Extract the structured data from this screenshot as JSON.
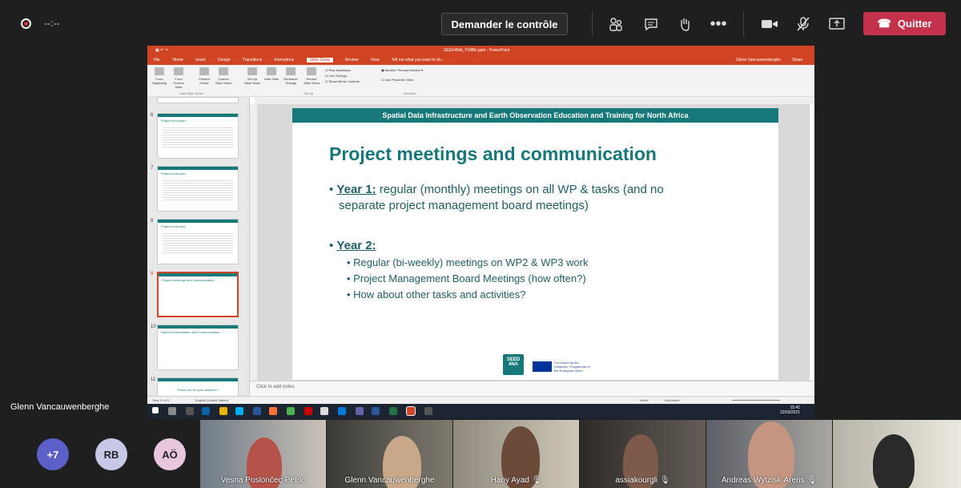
{
  "topbar": {
    "timer": "--:--",
    "control_label": "Demander le contrôle",
    "quit_label": "Quitter",
    "icons": [
      "participants-icon",
      "chat-icon",
      "raise-hand-icon",
      "more-icon",
      "camera-icon",
      "mic-off-icon",
      "share-icon"
    ]
  },
  "powerpoint": {
    "window_title": "SEED4NA_TIMBE.pptx - PowerPoint",
    "search_hint": "Tell me what you want to do...",
    "user": "Glenn Vancauwenberghe",
    "share": "Share",
    "tabs": [
      "File",
      "Home",
      "Insert",
      "Design",
      "Transitions",
      "Animations",
      "Slide Show",
      "Review",
      "View"
    ],
    "active_tab": "Slide Show",
    "ribbon": {
      "from_beginning": "From Beginning",
      "from_current": "From Current Slide",
      "present_online": "Present Online",
      "custom_show": "Custom Slide Show",
      "setup_show": "Set Up Slide Show",
      "hide_slide": "Hide Slide",
      "rehearse": "Rehearse Timings",
      "record": "Record Slide Show",
      "play_narrations": "Play Narrations",
      "use_timings": "Use Timings",
      "show_media": "Show Media Controls",
      "monitor_label": "Monitor:",
      "monitor_value": "Primary Monitor",
      "presenter_view": "Use Presenter View",
      "group_start": "Start Slide Show",
      "group_setup": "Set Up",
      "group_monitors": "Monitors"
    },
    "thumbnails": [
      {
        "num": "6",
        "title": "Project work plan"
      },
      {
        "num": "7",
        "title": "Project work plan"
      },
      {
        "num": "8",
        "title": "Project work plan"
      },
      {
        "num": "9",
        "title": "Project meetings and communication"
      },
      {
        "num": "10",
        "title": "National coordination and communication"
      },
      {
        "num": "11",
        "title": "Thank you for your attention !"
      }
    ],
    "notes_placeholder": "Click to add notes",
    "status_slide": "Slide 9 of 11",
    "status_lang": "English (United States)",
    "status_notes": "Notes",
    "status_comments": "Comments",
    "clock_time": "15:41",
    "clock_date": "22/03/2021"
  },
  "slide": {
    "header": "Spatial Data Infrastructure and Earth Observation Education and Training for North Africa",
    "title": "Project meetings and communication",
    "year1_label": "Year 1:",
    "year1_text": "regular (monthly) meetings on all WP & tasks (and no",
    "year1_text2": "separate project management board meetings)",
    "year2_label": "Year 2:",
    "sub1": "Regular (bi-weekly) meetings on WP2 & WP3 work",
    "sub2": "Project Management Board Meetings (how often?)",
    "sub3": "How about other tasks and activities?",
    "logo_text": "SEED 4NA",
    "eu_text": "Co-funded by the Erasmus+ Programme of the European Union"
  },
  "meeting": {
    "presenter_name": "Glenn Vancauwenberghe",
    "overflow_count": "+7",
    "avatars": [
      "RB",
      "AÖ"
    ],
    "participants": [
      "Vesna Poslončec-Petrić",
      "Glenn Vancauwenberghe",
      "Hany Ayad",
      "assiakourgli",
      "Andreas Wytzisk-Arens",
      ""
    ]
  },
  "colors": {
    "quit": "#c4314b",
    "ppt": "#d04423",
    "slide_teal": "#17787a"
  }
}
